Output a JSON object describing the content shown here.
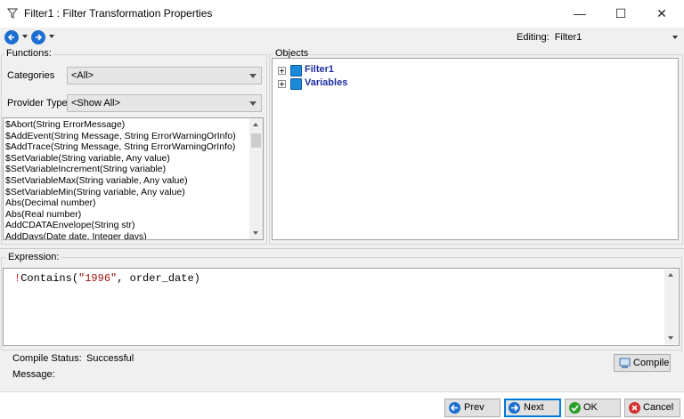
{
  "window": {
    "title": "Filter1 : Filter Transformation Properties"
  },
  "window_controls": {
    "minimize": "—",
    "maximize": "☐",
    "close": "✕"
  },
  "toolbar": {
    "editing_label": "Editing:",
    "editing_value": "Filter1"
  },
  "functions": {
    "group_label": "Functions:",
    "categories_label": "Categories",
    "categories_value": "<All>",
    "provider_label": "Provider Type",
    "provider_value": "<Show All>",
    "items": [
      "$Abort(String ErrorMessage)",
      "$AddEvent(String Message, String ErrorWarningOrInfo)",
      "$AddTrace(String Message, String ErrorWarningOrInfo)",
      "$SetVariable(String variable, Any value)",
      "$SetVariableIncrement(String variable)",
      "$SetVariableMax(String variable, Any value)",
      "$SetVariableMin(String variable, Any value)",
      "Abs(Decimal number)",
      "Abs(Real number)",
      "AddCDATAEnvelope(String str)",
      "AddDays(Date date, Integer days)"
    ]
  },
  "objects": {
    "group_label": "Objects",
    "nodes": [
      "Filter1",
      "Variables"
    ]
  },
  "expression": {
    "label": "Expression:",
    "tokens": {
      "op": "!",
      "func": "Contains(",
      "str": "\"1996\"",
      "rest": ", order_date)"
    }
  },
  "status": {
    "compile_label": "Compile Status:",
    "compile_value": "Successful",
    "message_label": "Message:",
    "compile_button": "Compile"
  },
  "buttons": {
    "prev": "Prev",
    "next": "Next",
    "ok": "OK",
    "cancel": "Cancel"
  },
  "colors": {
    "accent": "#1c6fd0",
    "ok_green": "#2ca02c",
    "cancel_red": "#d32f2f",
    "tree_text": "#1f2fa0"
  }
}
